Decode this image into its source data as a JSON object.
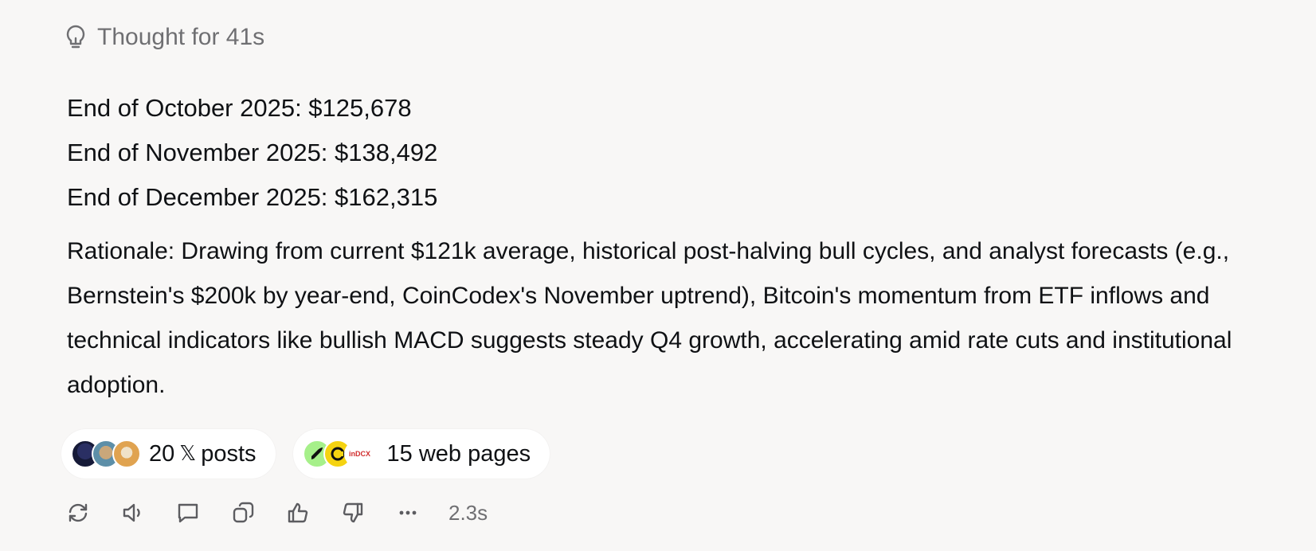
{
  "thought": {
    "label": "Thought for 41s",
    "icon": "lightbulb-icon"
  },
  "prices": [
    "End of October 2025: $125,678",
    "End of November 2025: $138,492",
    "End of December 2025: $162,315"
  ],
  "rationale": "Rationale: Drawing from current $121k average, historical post-halving bull cycles, and analyst forecasts (e.g., Bernstein's $200k by year-end, CoinCodex's November uptrend), Bitcoin's momentum from ETF inflows and technical indicators like bullish MACD suggests steady Q4 growth, accelerating amid rate cuts and institutional adoption.",
  "sources": {
    "x_posts": {
      "count": "20",
      "x_glyph": "𝕏",
      "label": "posts"
    },
    "web_pages": {
      "label": "15 web pages",
      "favicon3_text": "inDCX"
    }
  },
  "actions": {
    "icons": [
      "regenerate-icon",
      "read-aloud-icon",
      "comment-icon",
      "copy-icon",
      "thumbs-up-icon",
      "thumbs-down-icon",
      "more-icon"
    ],
    "timing": "2.3s"
  }
}
